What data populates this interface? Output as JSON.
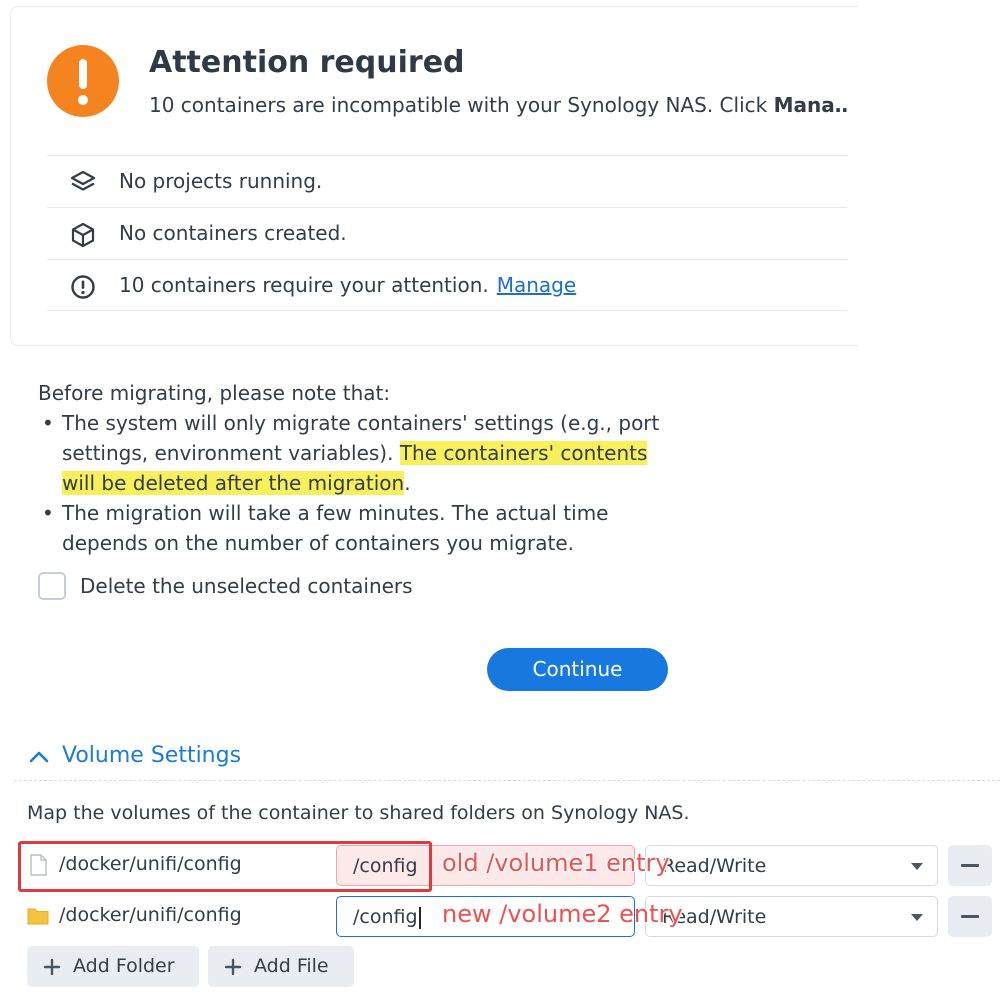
{
  "attention": {
    "title": "Attention required",
    "subtitle_prefix": "10 containers are incompatible with your Synology NAS. Click ",
    "subtitle_bold": "Mana…",
    "rows": [
      {
        "icon": "layers-icon",
        "text": "No projects running."
      },
      {
        "icon": "box-icon",
        "text": "No containers created."
      },
      {
        "icon": "alert-circle-icon",
        "text": "10 containers require your attention.",
        "link": "Manage"
      }
    ]
  },
  "migration": {
    "intro": "Before migrating, please note that:",
    "bullet1_plain": "The system will only migrate containers' settings (e.g., port settings, environment variables). ",
    "bullet1_highlight": "The containers' contents will be deleted after the migration",
    "bullet1_end": ".",
    "bullet2": "The migration will take a few minutes. The actual time depends on the number of containers you migrate.",
    "checkbox_label": "Delete the unselected containers",
    "continue_label": "Continue"
  },
  "volume_settings": {
    "header": "Volume Settings",
    "description": "Map the volumes of the container to shared folders on Synology NAS.",
    "rows": [
      {
        "icon": "file-icon",
        "folder": "/docker/unifi/config",
        "mount": "/config",
        "permission": "Read/Write"
      },
      {
        "icon": "folder-icon",
        "folder": "/docker/unifi/config",
        "mount": "/config",
        "permission": "Read/Write"
      }
    ],
    "add_folder_label": "Add Folder",
    "add_file_label": "Add File"
  },
  "annotations": {
    "old_entry": "old /volume1 entry",
    "new_entry": "new /volume2 entry"
  },
  "colors": {
    "accent": "#1779e0",
    "warning": "#f58420",
    "highlight": "#f8f05a",
    "annotation_red": "#e03b3b"
  }
}
